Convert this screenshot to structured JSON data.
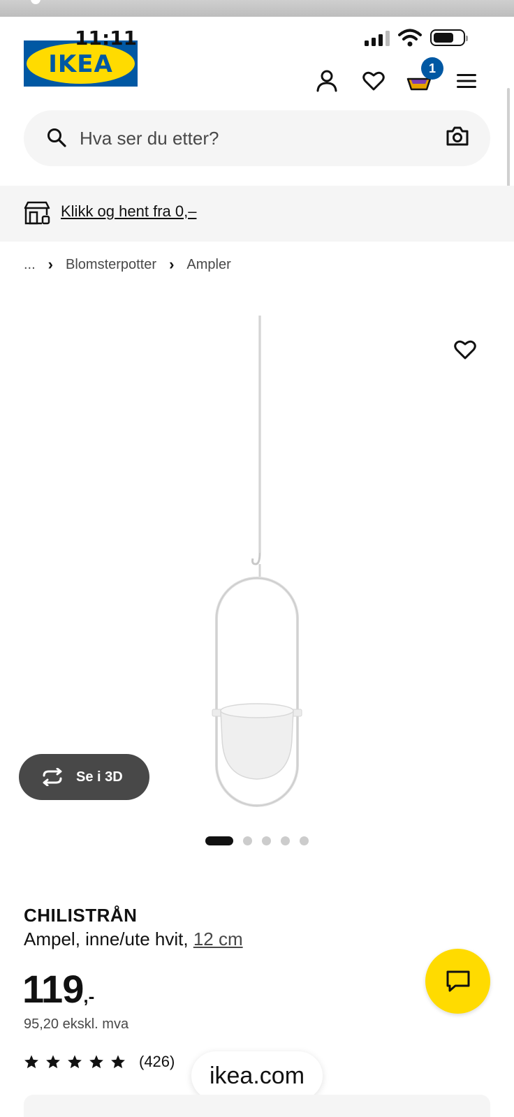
{
  "status": {
    "time": "11:11"
  },
  "header": {
    "logo_text": "IKEA",
    "cart_count": "1",
    "icons": [
      "user-icon",
      "heart-icon",
      "cart-icon",
      "menu-icon"
    ]
  },
  "search": {
    "placeholder": "Hva ser du etter?"
  },
  "promo": {
    "label": "Klikk og hent fra 0,–"
  },
  "breadcrumb": {
    "items": [
      "...",
      "Blomsterpotter",
      "Ampler"
    ]
  },
  "gallery": {
    "view3d_label": "Se i 3D",
    "slides": 5,
    "active_slide": 1
  },
  "product": {
    "name": "CHILISTRÅN",
    "description": "Ampel, inne/ute hvit, ",
    "size_link": "12 cm",
    "price": "119",
    "price_suffix": ",-",
    "price_ex_vat": "95,20 ekskl. mva",
    "rating": 5,
    "reviews": "(426)"
  },
  "browser": {
    "url": "ikea.com"
  },
  "colors": {
    "ikea_blue": "#0058a3",
    "ikea_yellow": "#ffdb00",
    "dark_button": "#484848"
  }
}
